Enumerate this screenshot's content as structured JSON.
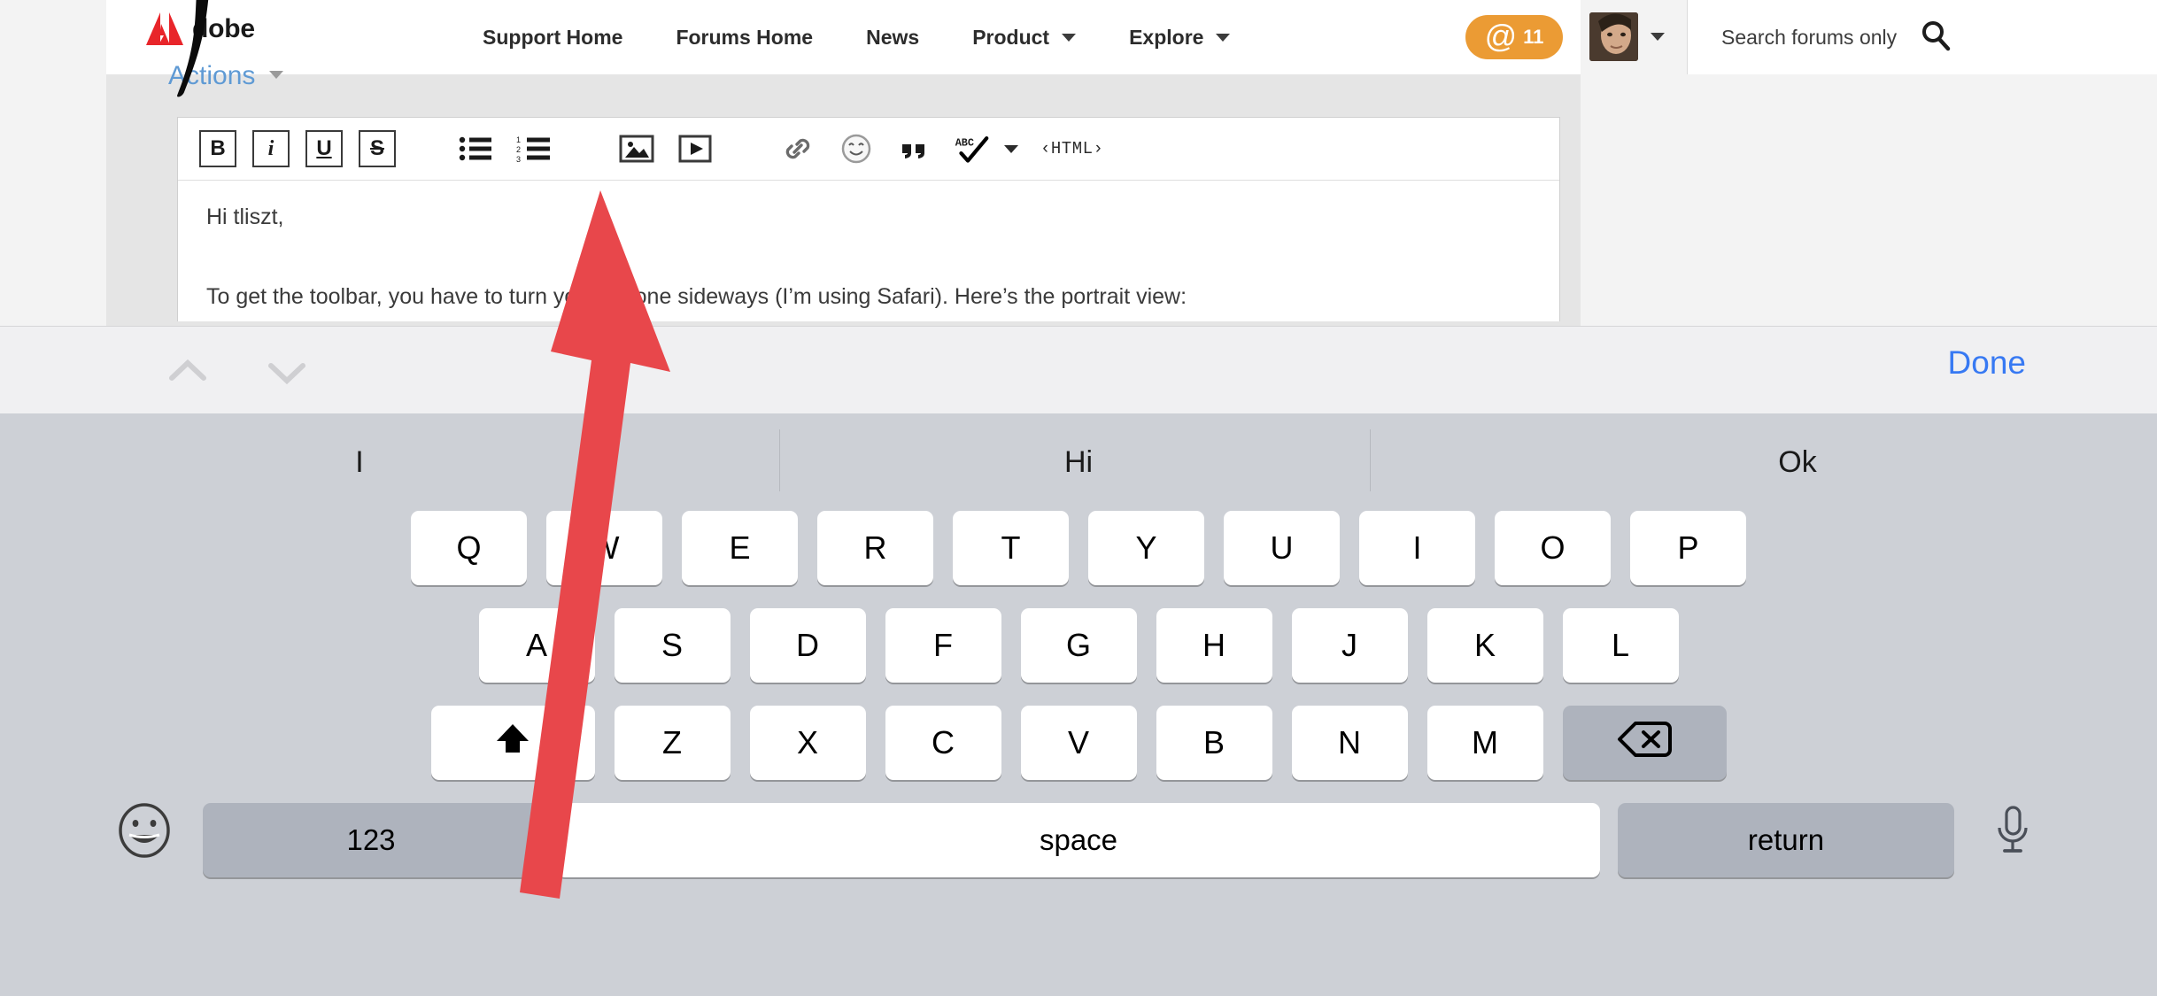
{
  "browser": {
    "nav": {
      "brand_word": "dobe",
      "brand_icon": "adobe-logo",
      "links": [
        {
          "label": "Support Home",
          "has_caret": false
        },
        {
          "label": "Forums Home",
          "has_caret": false
        },
        {
          "label": "News",
          "has_caret": false
        },
        {
          "label": "Product",
          "has_caret": true
        },
        {
          "label": "Explore",
          "has_caret": true
        }
      ],
      "mentions_badge": {
        "glyph": "@",
        "count": "11"
      },
      "search_placeholder": "Search forums only",
      "search_icon": "search-icon",
      "avatar_icon": "user-avatar"
    },
    "editor": {
      "actions_label": "Actions",
      "toolbar": [
        {
          "name": "bold",
          "label": "B"
        },
        {
          "name": "italic",
          "label": "i"
        },
        {
          "name": "underline",
          "label": "U"
        },
        {
          "name": "strikethrough",
          "label": "S"
        },
        {
          "name": "bullet-list",
          "label": ""
        },
        {
          "name": "numbered-list",
          "label": ""
        },
        {
          "name": "insert-image",
          "label": ""
        },
        {
          "name": "insert-video",
          "label": ""
        },
        {
          "name": "insert-link",
          "label": ""
        },
        {
          "name": "insert-emoji",
          "label": ""
        },
        {
          "name": "blockquote",
          "label": ""
        },
        {
          "name": "spellcheck",
          "label": "ABC"
        },
        {
          "name": "html-source",
          "label": "‹HTML›"
        }
      ],
      "html_label": "‹HTML›",
      "body": {
        "line1": "Hi tliszt,",
        "line2": "To get the toolbar, you have to turn your iPhone sideways (I’m using Safari). Here’s the portrait view:",
        "line2_visible_a": "To get the toolbar, you have to",
        "line2_visible_b": "ur iPhone sideways (I’m using Safari). Here’s the portrait view:"
      }
    }
  },
  "keyboard_accessory": {
    "prev_icon": "chevron-up-icon",
    "next_icon": "chevron-down-icon",
    "done_label": "Done"
  },
  "keyboard": {
    "predictions": [
      "I",
      "Hi",
      "Ok"
    ],
    "row1": [
      "Q",
      "W",
      "E",
      "R",
      "T",
      "Y",
      "U",
      "I",
      "O",
      "P"
    ],
    "row2": [
      "A",
      "S",
      "D",
      "F",
      "G",
      "H",
      "J",
      "K",
      "L"
    ],
    "row3": [
      "Z",
      "X",
      "C",
      "V",
      "B",
      "N",
      "M"
    ],
    "shift_icon": "shift-up-arrow-icon",
    "backspace_icon": "backspace-delete-icon",
    "emoji_icon": "smiley-face-icon",
    "numeric_label": "123",
    "space_label": "space",
    "return_label": "return",
    "dictation_icon": "microphone-icon"
  },
  "annotation": {
    "arrow_icon": "red-arrow-annotation",
    "arrow_color": "#e8474b",
    "swoosh_icon": "black-swoosh-annotation"
  },
  "colors": {
    "adobe_red": "#e8252a",
    "badge_orange": "#eb9b34",
    "done_blue": "#3779f3",
    "actions_blue": "#5f9ad4",
    "keyboard_bg": "#cdd0d6",
    "key_dark": "#aeb3bd"
  }
}
